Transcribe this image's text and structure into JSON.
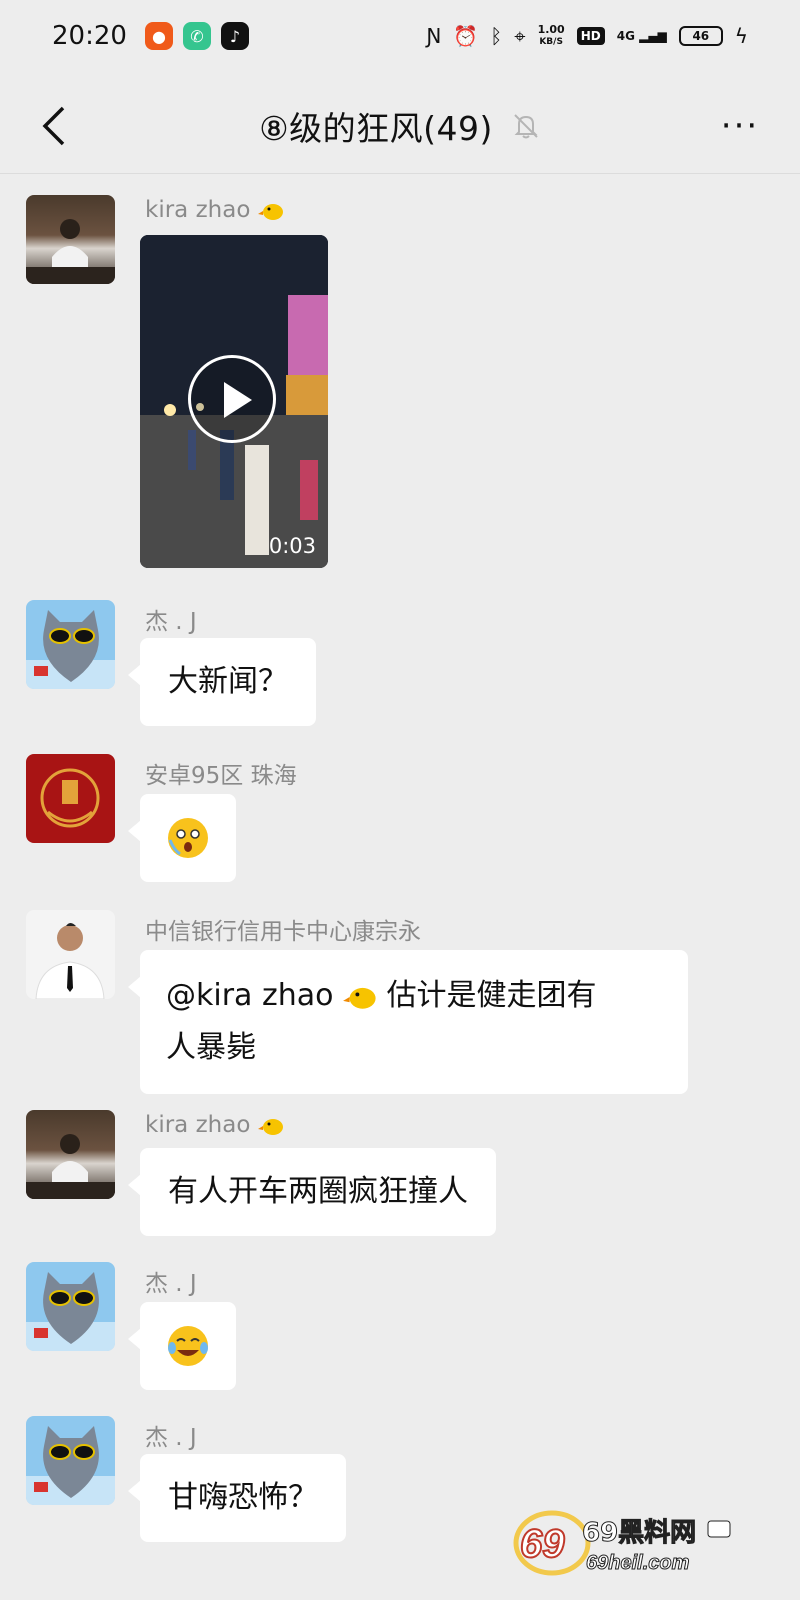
{
  "status_bar": {
    "time": "20:20",
    "speed_value": "1.00",
    "speed_unit": "KB/S",
    "hd": "HD",
    "network": "4G",
    "battery": "46"
  },
  "nav": {
    "title": "⑧级的狂风(49)",
    "more": "···"
  },
  "messages": [
    {
      "sender": "kira zhao",
      "type": "video",
      "duration": "0:03"
    },
    {
      "sender": "杰 . J",
      "type": "text",
      "text": "大新闻？"
    },
    {
      "sender": "安卓95区  珠海",
      "type": "emoji",
      "emoji": "surprised-face"
    },
    {
      "sender": "中信银行信用卡中心康宗永",
      "type": "text",
      "mention": "@kira zhao",
      "text_line1": "估计是健走团有",
      "text_line2": "人暴毙"
    },
    {
      "sender": "kira zhao",
      "type": "text",
      "text": "有人开车两圈疯狂撞人"
    },
    {
      "sender": "杰 . J",
      "type": "emoji",
      "emoji": "laughing-tears-face"
    },
    {
      "sender": "杰 . J",
      "type": "text",
      "text": "甘嗨恐怖？"
    }
  ],
  "watermark": {
    "line1": "69黑料网",
    "line2": "69heil.com"
  },
  "colors": {
    "background": "#ededed",
    "bubble": "#ffffff",
    "sender_name": "#8a8a8a"
  }
}
